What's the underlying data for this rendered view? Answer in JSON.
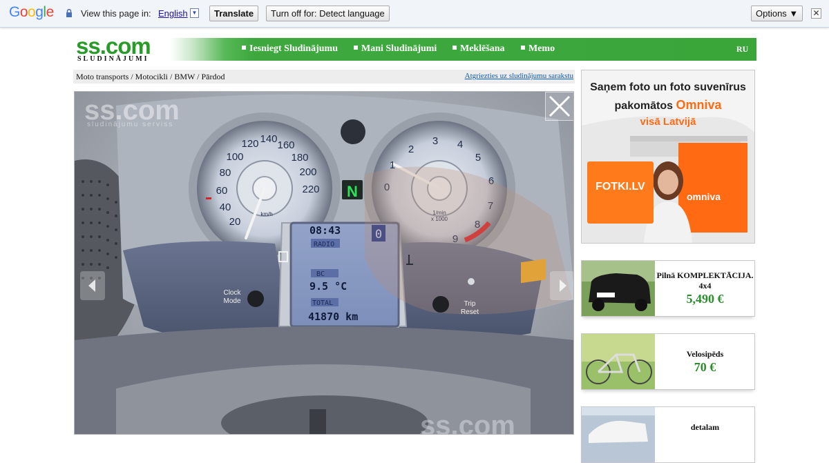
{
  "translate_bar": {
    "logo_letters": [
      "G",
      "o",
      "o",
      "g",
      "l",
      "e"
    ],
    "logo_colors": [
      "#4285f4",
      "#ea4335",
      "#fbbc05",
      "#4285f4",
      "#34a853",
      "#ea4335"
    ],
    "prompt": "View this page in:",
    "language": "English",
    "translate_label": "Translate",
    "turn_off_label": "Turn off for: Detect language",
    "options_label": "Options ▼",
    "close_glyph": "✕"
  },
  "site": {
    "logo_main": "ss.com",
    "logo_sub": "SLUDINĀJUMI",
    "nav": [
      {
        "label": "Iesniegt Sludinājumu"
      },
      {
        "label": "Mani Sludinājumi"
      },
      {
        "label": "Meklēšana"
      },
      {
        "label": "Memo"
      }
    ],
    "lang_switch": "RU"
  },
  "breadcrumb": {
    "path": "Moto transports / Motocikli / BMW / Pārdod",
    "back_link": "Atgriezties uz sludinājumu sarakstu"
  },
  "photo": {
    "watermark": "ss.com",
    "watermark_sub": "sludinājumu serviss",
    "speedo_ticks": [
      "20",
      "40",
      "60",
      "80",
      "100",
      "120",
      "140",
      "160",
      "180",
      "200",
      "220"
    ],
    "speedo_unit": "km/h",
    "tacho_ticks": [
      "0",
      "1",
      "2",
      "3",
      "4",
      "5",
      "6",
      "7",
      "8",
      "9"
    ],
    "tacho_unit": "1/min",
    "tacho_unit2": "x 1000",
    "gear": "N",
    "lcd_time": "08:43",
    "lcd_gear_num": "0",
    "lcd_radio": "RADIO",
    "lcd_bc": "BC",
    "lcd_temp": "9.5 °C",
    "lcd_total": "TOTAL",
    "lcd_km": "41870 km",
    "btn_left": "Clock\nMode",
    "btn_left_1": "Clock",
    "btn_left_2": "Mode",
    "btn_right_1": "Trip",
    "btn_right_2": "Reset"
  },
  "ad": {
    "line1": "Saņem foto un foto suvenīrus",
    "line2_a": "pakomātos ",
    "line2_b": "Omniva",
    "line3": "visā Latvijā",
    "fotki": "FOTKI.LV",
    "omniva": "omniva"
  },
  "listings": [
    {
      "title": "Pilnā KOMPLEKTĀCIJA. 4x4",
      "price": "5,490 €"
    },
    {
      "title": "Velosipēds",
      "price": "70 €"
    },
    {
      "title": "detalam",
      "price": ""
    }
  ]
}
